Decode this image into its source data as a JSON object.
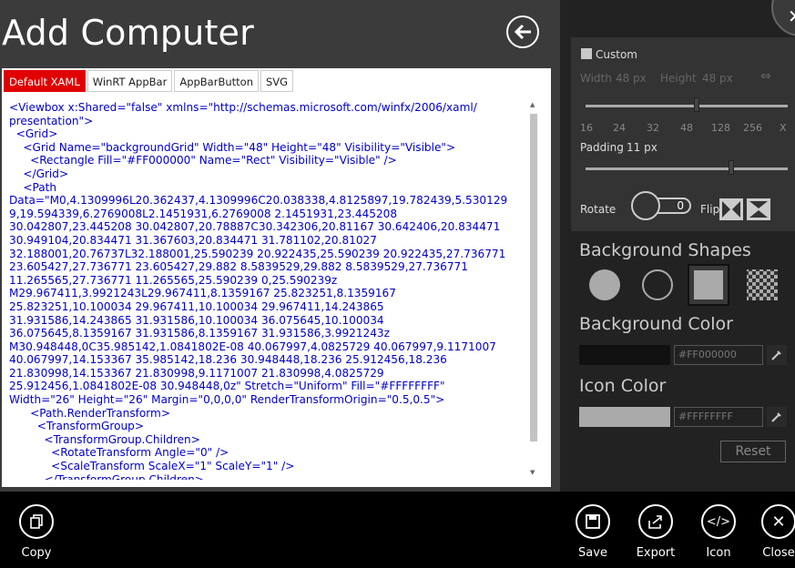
{
  "title": "Add Computer",
  "tabs": [
    "Default XAML",
    "WinRT AppBar",
    "AppBarButton",
    "SVG"
  ],
  "code": [
    "<Viewbox x:Shared=\"false\" xmlns=\"http://schemas.microsoft.com/winfx/2006/xaml/",
    "presentation\">",
    "  <Grid>",
    "    <Grid Name=\"backgroundGrid\" Width=\"48\" Height=\"48\" Visibility=\"Visible\">",
    "      <Rectangle Fill=\"#FF000000\" Name=\"Rect\" Visibility=\"Visible\" />",
    "    </Grid>",
    "    <Path",
    "Data=\"M0,4.1309996L20.362437,4.1309996C20.038338,4.8125897,19.782439,5.530129",
    "9,19.594339,6.2769008L2.1451931,6.2769008 2.1451931,23.445208",
    "30.042807,23.445208 30.042807,20.78887C30.342306,20.81167 30.642406,20.834471",
    "30.949104,20.834471 31.367603,20.834471 31.781102,20.81027",
    "32.188001,20.76737L32.188001,25.590239 20.922435,25.590239 20.922435,27.736771",
    "23.605427,27.736771 23.605427,29.882 8.5839529,29.882 8.5839529,27.736771",
    "11.265565,27.736771 11.265565,25.590239 0,25.590239z",
    "M29.967411,3.9921243L29.967411,8.1359167 25.823251,8.1359167",
    "25.823251,10.100034 29.967411,10.100034 29.967411,14.243865",
    "31.931586,14.243865 31.931586,10.100034 36.075645,10.100034",
    "36.075645,8.1359167 31.931586,8.1359167 31.931586,3.9921243z",
    "M30.948448,0C35.985142,1.0841802E-08 40.067997,4.0825729 40.067997,9.1171007",
    "40.067997,14.153367 35.985142,18.236 30.948448,18.236 25.912456,18.236",
    "21.830998,14.153367 21.830998,9.1171007 21.830998,4.0825729",
    "25.912456,1.0841802E-08 30.948448,0z\" Stretch=\"Uniform\" Fill=\"#FFFFFFFF\"",
    "Width=\"26\" Height=\"26\" Margin=\"0,0,0,0\" RenderTransformOrigin=\"0.5,0.5\">",
    "      <Path.RenderTransform>",
    "        <TransformGroup>",
    "          <TransformGroup.Children>",
    "            <RotateTransform Angle=\"0\" />",
    "            <ScaleTransform ScaleX=\"1\" ScaleY=\"1\" />",
    "          </TransformGroup.Children>"
  ],
  "settings": {
    "custom_label": "Custom",
    "width_label": "Width",
    "width_value": "48",
    "width_unit": "px",
    "height_label": "Height",
    "height_value": "48",
    "height_unit": "px",
    "size_ticks": [
      "16",
      "24",
      "32",
      "48",
      "128",
      "256",
      "X"
    ],
    "padding_label": "Padding",
    "padding_value": "11 px",
    "rotate_label": "Rotate",
    "rotate_value": "0",
    "flip_label": "Flip",
    "size_slider_fraction": 0.55,
    "padding_slider_fraction": 0.72
  },
  "background_shapes_label": "Background Shapes",
  "background_color_label": "Background Color",
  "background_color_hex": "#FF000000",
  "icon_color_label": "Icon Color",
  "icon_color_hex": "#FFFFFFFF",
  "reset_label": "Reset",
  "appbar": {
    "copy": "Copy",
    "save": "Save",
    "export": "Export",
    "icon": "Icon",
    "close": "Close"
  },
  "colors": {
    "accent_tab": "#e00000",
    "main_bg": "#3b3b3b",
    "side_bg": "#222222"
  }
}
